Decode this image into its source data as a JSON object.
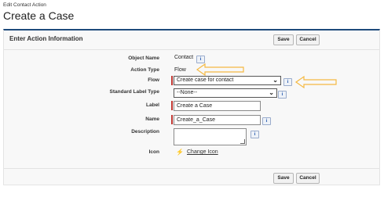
{
  "breadcrumb": "Edit Contact Action",
  "page_title": "Create a Case",
  "section_title": "Enter Action Information",
  "buttons": {
    "save": "Save",
    "cancel": "Cancel"
  },
  "fields": {
    "object_name": {
      "label": "Object Name",
      "value": "Contact"
    },
    "action_type": {
      "label": "Action Type",
      "value": "Flow"
    },
    "flow": {
      "label": "Flow",
      "value": "Create case for contact"
    },
    "standard_label_type": {
      "label": "Standard Label Type",
      "value": "--None--"
    },
    "label": {
      "label": "Label",
      "value": "Create a Case"
    },
    "name": {
      "label": "Name",
      "value": "Create_a_Case"
    },
    "description": {
      "label": "Description",
      "value": ""
    },
    "icon": {
      "label": "Icon",
      "link": "Change Icon"
    }
  },
  "icons": {
    "info": "i",
    "lightning": "⚡"
  },
  "colors": {
    "header_border": "#1e4a7b",
    "required": "#c23934",
    "arrow": "#f5b942"
  }
}
